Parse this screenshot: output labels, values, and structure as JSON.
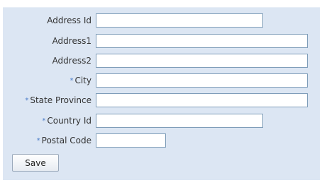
{
  "form": {
    "fields": [
      {
        "label": "Address Id",
        "required": false,
        "value": ""
      },
      {
        "label": "Address1",
        "required": false,
        "value": ""
      },
      {
        "label": "Address2",
        "required": false,
        "value": ""
      },
      {
        "label": "City",
        "required": true,
        "value": ""
      },
      {
        "label": "State Province",
        "required": true,
        "value": ""
      },
      {
        "label": "Country Id",
        "required": true,
        "value": ""
      },
      {
        "label": "Postal Code",
        "required": true,
        "value": ""
      }
    ],
    "required_marker": "*",
    "save_label": "Save"
  }
}
